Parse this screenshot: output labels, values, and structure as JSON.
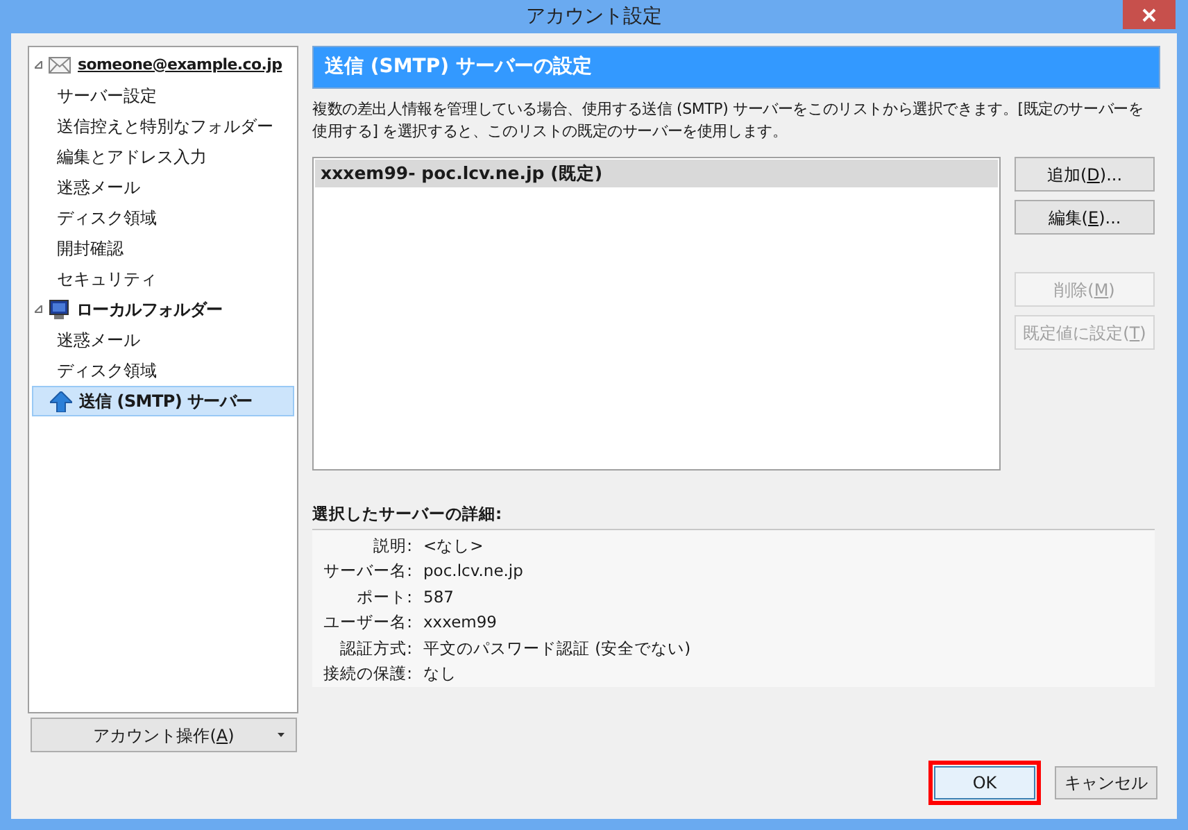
{
  "window": {
    "title": "アカウント設定"
  },
  "tree": [
    {
      "label": "someone@example.co.jp",
      "kind": "mail",
      "expanded": true,
      "selected": false,
      "children": [
        {
          "label": "サーバー設定",
          "selected": false
        },
        {
          "label": "送信控えと特別なフォルダー",
          "selected": false
        },
        {
          "label": "編集とアドレス入力",
          "selected": false
        },
        {
          "label": "迷惑メール",
          "selected": false
        },
        {
          "label": "ディスク領域",
          "selected": false
        },
        {
          "label": "開封確認",
          "selected": false
        },
        {
          "label": "セキュリティ",
          "selected": false
        }
      ]
    },
    {
      "label": "ローカルフォルダー",
      "kind": "local",
      "expanded": true,
      "selected": false,
      "children": [
        {
          "label": "迷惑メール",
          "selected": false
        },
        {
          "label": "ディスク領域",
          "selected": false
        }
      ]
    },
    {
      "label": "送信 (SMTP) サーバー",
      "kind": "smtp",
      "selected": true
    }
  ],
  "account_actions": {
    "before": "アカウント操作(",
    "key": "A",
    "after": ")"
  },
  "panel": {
    "title": "送信 (SMTP) サーバーの設定",
    "description": "複数の差出人情報を管理している場合、使用する送信 (SMTP) サーバーをこのリストから選択できます。[既定のサーバーを使用する] を選択すると、このリストの既定のサーバーを使用します。",
    "servers": [
      {
        "label": "xxxem99- poc.lcv.ne.jp (既定)",
        "selected": true
      }
    ],
    "buttons": [
      {
        "before": "追加(",
        "key": "D",
        "after": ")...",
        "disabled": false
      },
      {
        "before": "編集(",
        "key": "E",
        "after": ")...",
        "disabled": false
      },
      {
        "before": "削除(",
        "key": "M",
        "after": ")",
        "disabled": true
      },
      {
        "before": "既定値に設定(",
        "key": "T",
        "after": ")",
        "disabled": true
      }
    ],
    "details_title": "選択したサーバーの詳細:",
    "details": [
      {
        "label": "説明:",
        "value": "<なし>"
      },
      {
        "label": "サーバー名:",
        "value": "poc.lcv.ne.jp"
      },
      {
        "label": "ポート:",
        "value": "587"
      },
      {
        "label": "ユーザー名:",
        "value": "xxxem99"
      },
      {
        "label": "認証方式:",
        "value": "平文のパスワード認証 (安全でない)"
      },
      {
        "label": "接続の保護:",
        "value": "なし"
      }
    ]
  },
  "footer": [
    {
      "label": "OK",
      "highlighted": true
    },
    {
      "label": "キャンセル",
      "highlighted": false
    }
  ]
}
